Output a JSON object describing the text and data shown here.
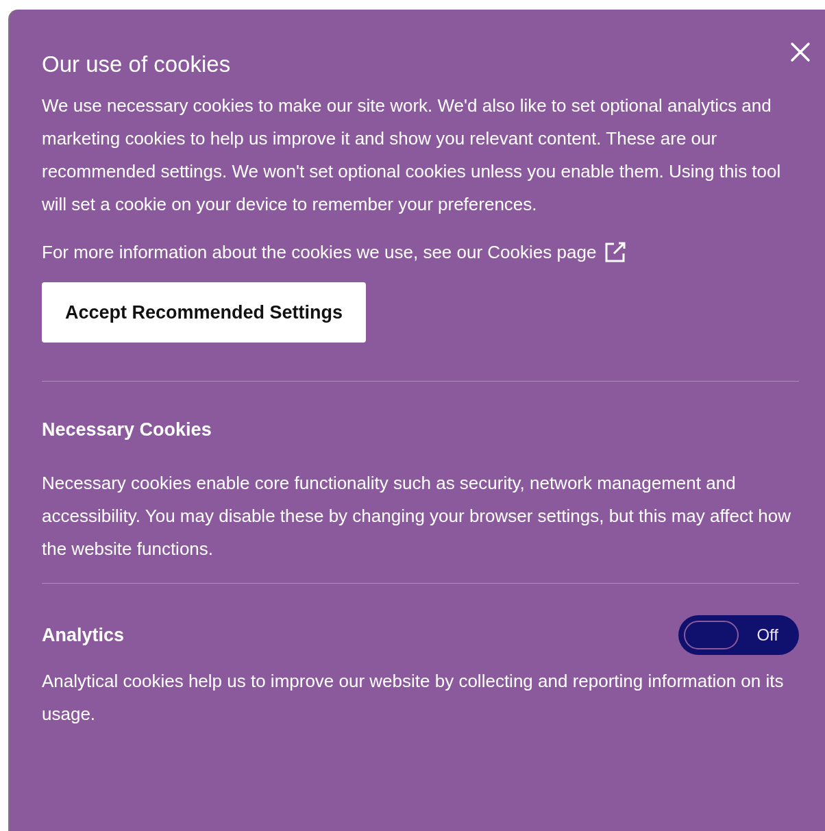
{
  "dialog": {
    "title": "Our use of cookies",
    "intro": "We use necessary cookies to make our site work. We'd also like to set optional analytics and marketing cookies to help us improve it and show you relevant content. These are our recommended settings. We won't set optional cookies unless you enable them. Using this tool will set a cookie on your device to remember your preferences.",
    "more_info": {
      "text": "For more information about the cookies we use, see our ",
      "link": "Cookies page"
    },
    "accept_button": "Accept Recommended Settings",
    "sections": [
      {
        "kind": "static",
        "title": "Necessary Cookies",
        "description": "Necessary cookies enable core functionality such as security, network management and accessibility. You may disable these by changing your browser settings, but this may affect how the website functions."
      },
      {
        "kind": "toggle",
        "title": "Analytics",
        "on": false,
        "toggle_label": "Off",
        "description": "Analytical cookies help us to improve our website by collecting and reporting information on its usage."
      }
    ]
  }
}
